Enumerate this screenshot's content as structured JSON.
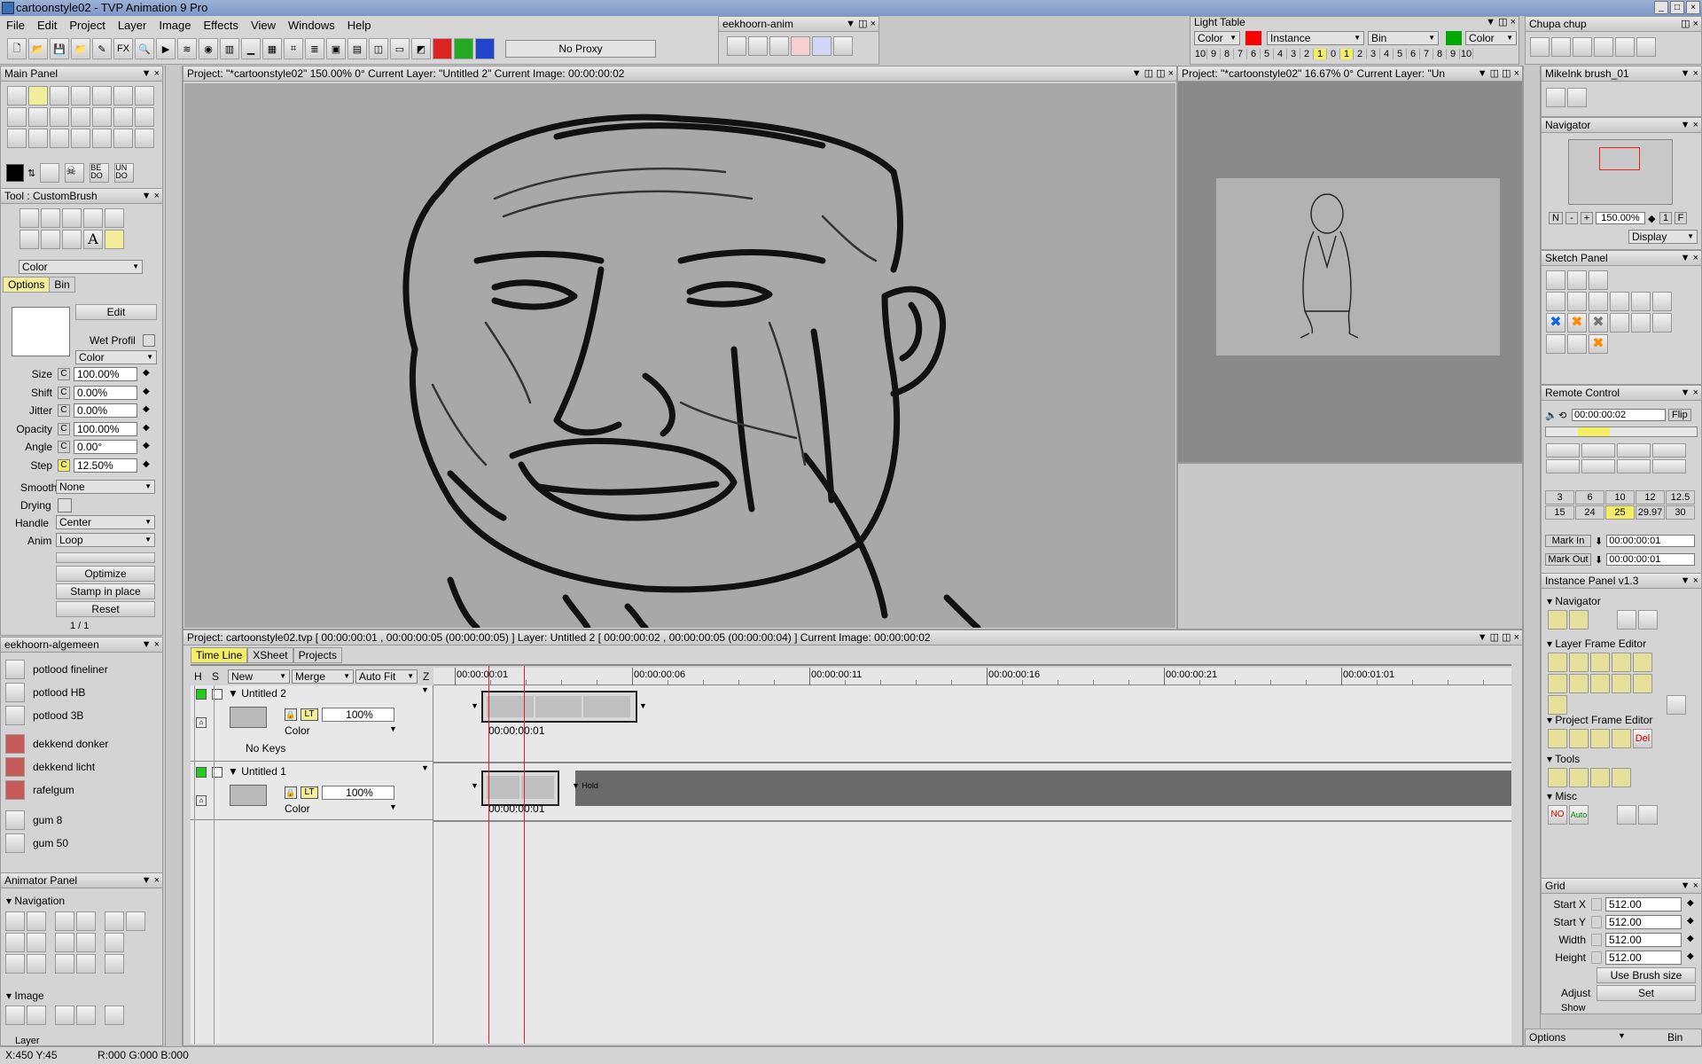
{
  "window": {
    "title": "cartoonstyle02 - TVP Animation 9 Pro"
  },
  "menu": [
    "File",
    "Edit",
    "Project",
    "Layer",
    "Image",
    "Effects",
    "View",
    "Windows",
    "Help"
  ],
  "toolbar": {
    "proxy": "No Proxy"
  },
  "eekhoorn_anim": {
    "title": "eekhoorn-anim"
  },
  "light_table": {
    "title": "Light Table",
    "mode": "Color",
    "instance": "Instance",
    "bin": "Bin",
    "color2": "Color",
    "before": [
      "10",
      "9",
      "8",
      "7",
      "6",
      "5",
      "4",
      "3",
      "2",
      "1"
    ],
    "zero": "0",
    "after": [
      "1",
      "2",
      "3",
      "4",
      "5",
      "6",
      "7",
      "8",
      "9",
      "10"
    ],
    "colors": {
      "before": "#ff0000",
      "after": "#00aa00"
    }
  },
  "chupa": {
    "title": "Chupa chup"
  },
  "main_panel": {
    "title": "Main Panel"
  },
  "tool_panel": {
    "title": "Tool : CustomBrush",
    "mode": "Color",
    "tabs": [
      "Options",
      "Bin"
    ],
    "edit": "Edit",
    "wet_profil": "Wet Profil",
    "color": "Color",
    "params": [
      {
        "label": "Size",
        "value": "100.00%"
      },
      {
        "label": "Shift",
        "value": "0.00%"
      },
      {
        "label": "Jitter",
        "value": "0.00%"
      },
      {
        "label": "Opacity",
        "value": "100.00%"
      },
      {
        "label": "Angle",
        "value": "0.00°"
      },
      {
        "label": "Step",
        "value": "12.50%"
      }
    ],
    "smooth_label": "Smooth",
    "smooth": "None",
    "drying": "Drying",
    "handle_label": "Handle",
    "handle": "Center",
    "anim_label": "Anim",
    "anim": "Loop",
    "optimize": "Optimize",
    "stamp": "Stamp in place",
    "reset": "Reset",
    "page": "1 / 1",
    "cflag": "C"
  },
  "eekhoorn_alg": {
    "title": "eekhoorn-algemeen",
    "items": [
      "potlood fineliner",
      "potlood HB",
      "potlood 3B",
      "dekkend donker",
      "dekkend licht",
      "rafelgum",
      "gum 8",
      "gum 50"
    ]
  },
  "animator": {
    "title": "Animator Panel",
    "navigation": "Navigation",
    "image": "Image",
    "layer": "Layer"
  },
  "canvas": {
    "header": "Project: \"*cartoonstyle02\"  150.00%  0°  Current Layer: \"Untitled 2\"  Current Image: 00:00:00:02"
  },
  "preview": {
    "header": "Project: \"*cartoonstyle02\"  16.67%  0°  Current Layer: \"Un"
  },
  "timeline": {
    "header": "Project: cartoonstyle02.tvp [ 00:00:00:01 , 00:00:00:05  (00:00:00:05) ]      Layer: Untitled 2 [ 00:00:00:02 , 00:00:00:05  (00:00:00:04) ]      Current Image: 00:00:00:02",
    "tabs": [
      "Time Line",
      "XSheet",
      "Projects"
    ],
    "cols": {
      "h": "H",
      "s": "S",
      "new": "New",
      "merge": "Merge",
      "autofit": "Auto Fit",
      "z": "Z"
    },
    "ruler": [
      "00:00:00:01",
      "00:00:00:06",
      "00:00:00:11",
      "00:00:00:16",
      "00:00:00:21",
      "00:00:01:01"
    ],
    "layers": [
      {
        "name": "Untitled 2",
        "lt": "LT",
        "opacity": "100%",
        "mode": "Color",
        "keys": "No Keys",
        "start": "00:00:00:01"
      },
      {
        "name": "Untitled 1",
        "lt": "LT",
        "opacity": "100%",
        "mode": "Color",
        "start": "00:00:00:01",
        "hold": "Hold"
      }
    ]
  },
  "mikeink": {
    "title": "MikeInk brush_01"
  },
  "navigator": {
    "title": "Navigator",
    "n": "N",
    "minus": "-",
    "plus": "+",
    "zoom": "150.00%",
    "one": "1",
    "f": "F",
    "display": "Display"
  },
  "sketch": {
    "title": "Sketch Panel"
  },
  "remote": {
    "title": "Remote Control",
    "time": "00:00:00:02",
    "flip": "Flip",
    "fps_row1": [
      "3",
      "6",
      "10",
      "12",
      "12.5"
    ],
    "fps_row2": [
      "15",
      "24",
      "25",
      "29.97",
      "30"
    ],
    "mark_in": "Mark In",
    "mark_in_val": "00:00:00:01",
    "mark_out": "Mark Out",
    "mark_out_val": "00:00:00:01"
  },
  "instance": {
    "title": "Instance Panel v1.3",
    "navigator": "Navigator",
    "lfe": "Layer Frame Editor",
    "pfe": "Project Frame Editor",
    "tools": "Tools",
    "misc": "Misc",
    "del": "Del",
    "no": "NO",
    "auto": "Auto"
  },
  "grid": {
    "title": "Grid",
    "fields": [
      {
        "label": "Start X",
        "value": "512.00"
      },
      {
        "label": "Start Y",
        "value": "512.00"
      },
      {
        "label": "Width",
        "value": "512.00"
      },
      {
        "label": "Height",
        "value": "512.00"
      }
    ],
    "use_brush": "Use Brush size",
    "adjust": "Adjust",
    "set": "Set",
    "show": "Show"
  },
  "bottom_right": {
    "options": "Options",
    "bin": "Bin"
  },
  "status": {
    "coords": "X:450  Y:45",
    "rgb": "R:000 G:000 B:000"
  }
}
